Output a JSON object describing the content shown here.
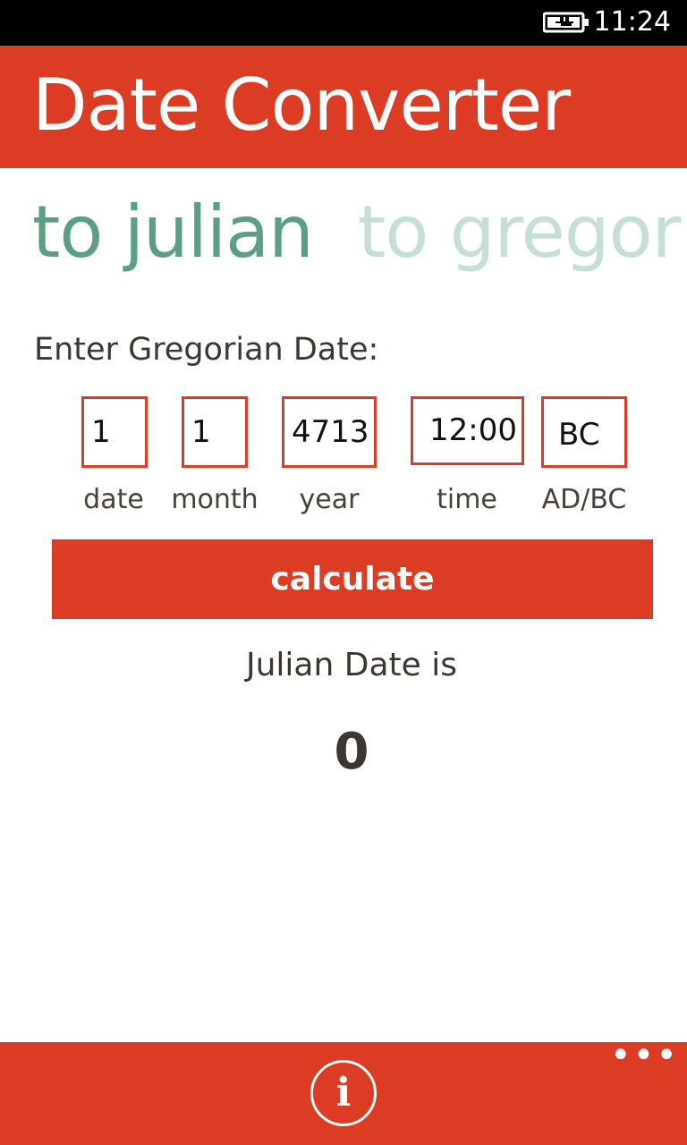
{
  "status_bar": {
    "time": "11:24",
    "battery_icon": "battery-charging-icon"
  },
  "header": {
    "title": "Date Converter"
  },
  "pivot": {
    "tabs": [
      {
        "label": "to julian",
        "active": true
      },
      {
        "label": "to gregorian",
        "active": false
      }
    ]
  },
  "form": {
    "prompt": "Enter Gregorian Date:",
    "fields": {
      "date": {
        "value": "1",
        "label": "date"
      },
      "month": {
        "value": "1",
        "label": "month"
      },
      "year": {
        "value": "4713",
        "label": "year"
      },
      "time": {
        "value": "12:00",
        "label": "time"
      },
      "era": {
        "value": "BC",
        "label": "AD/BC"
      }
    },
    "calculate_label": "calculate"
  },
  "result": {
    "label": "Julian Date is",
    "value": "0"
  },
  "app_bar": {
    "info_icon": "info-icon",
    "more_label": "•••"
  },
  "colors": {
    "accent": "#dd3c24",
    "pivot_active": "#5a9f82",
    "pivot_inactive": "#c6dfd3",
    "text": "#3c3630"
  }
}
